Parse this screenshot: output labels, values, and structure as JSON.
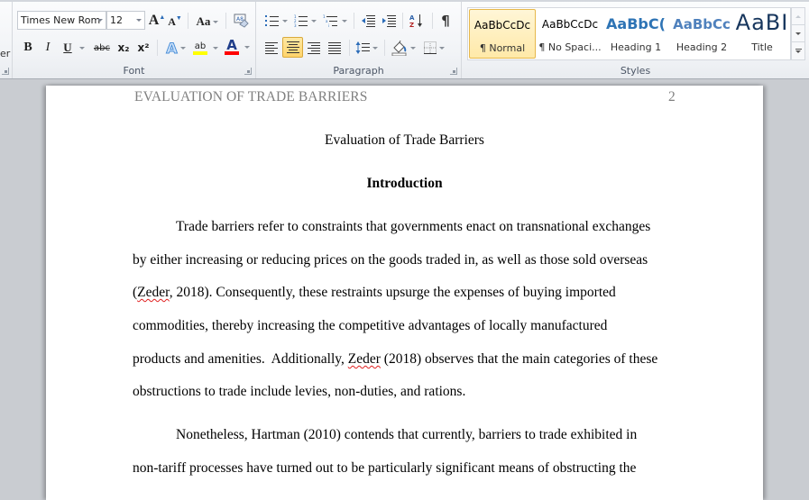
{
  "ribbon": {
    "clipboard": {
      "cut_label_fragment": "er"
    },
    "font": {
      "group_label": "Font",
      "font_name": "Times New Rom",
      "font_size": "12",
      "grow_font": "A",
      "shrink_font": "A",
      "change_case": "Aa",
      "bold": "B",
      "italic": "I",
      "underline": "U",
      "strikethrough": "abc",
      "subscript": "x₂",
      "superscript": "x²",
      "text_effects": "A",
      "highlight": "ab",
      "font_color": "A",
      "highlight_color": "#ffff00",
      "font_color_value": "#ff0000"
    },
    "paragraph": {
      "group_label": "Paragraph",
      "sort": "A↓",
      "show_marks": "¶",
      "active_alignment": "center"
    },
    "styles": {
      "group_label": "Styles",
      "items": [
        {
          "preview": "AaBbCcDc",
          "name": "¶ Normal",
          "selected": true
        },
        {
          "preview": "AaBbCcDc",
          "name": "¶ No Spaci...",
          "selected": false
        },
        {
          "preview": "AaBbC(",
          "name": "Heading 1",
          "selected": false
        },
        {
          "preview": "AaBbCc",
          "name": "Heading 2",
          "selected": false
        },
        {
          "preview": "AaBI",
          "name": "Title",
          "selected": false
        }
      ]
    }
  },
  "document": {
    "running_head": "EVALUATION OF TRADE BARRIERS",
    "page_number": "2",
    "title": "Evaluation of Trade Barriers",
    "heading": "Introduction",
    "lines": [
      {
        "pre": "Trade barriers refer to constraints that governments enact on transnational exchanges",
        "squig": "",
        "post": ""
      },
      {
        "pre": "by either increasing or reducing prices on the goods traded in, as well as those sold overseas",
        "squig": "",
        "post": ""
      },
      {
        "pre": "(",
        "squig": "Zeder",
        "post": ", 2018). Consequently, these restraints upsurge the expenses of buying imported"
      },
      {
        "pre": "commodities, thereby increasing the competitive advantages of locally manufactured",
        "squig": "",
        "post": ""
      },
      {
        "pre": "products and amenities.  Additionally, ",
        "squig": "Zeder",
        "post": " (2018) observes that the main categories of these"
      },
      {
        "pre": "obstructions to trade include levies, non-duties, and rations.",
        "squig": "",
        "post": ""
      },
      {
        "pre": "Nonetheless, Hartman (2010) contends that currently, barriers to trade exhibited in",
        "squig": "",
        "post": ""
      },
      {
        "pre": "non-tariff processes have turned out to be particularly significant means of obstructing the",
        "squig": "",
        "post": ""
      }
    ]
  }
}
